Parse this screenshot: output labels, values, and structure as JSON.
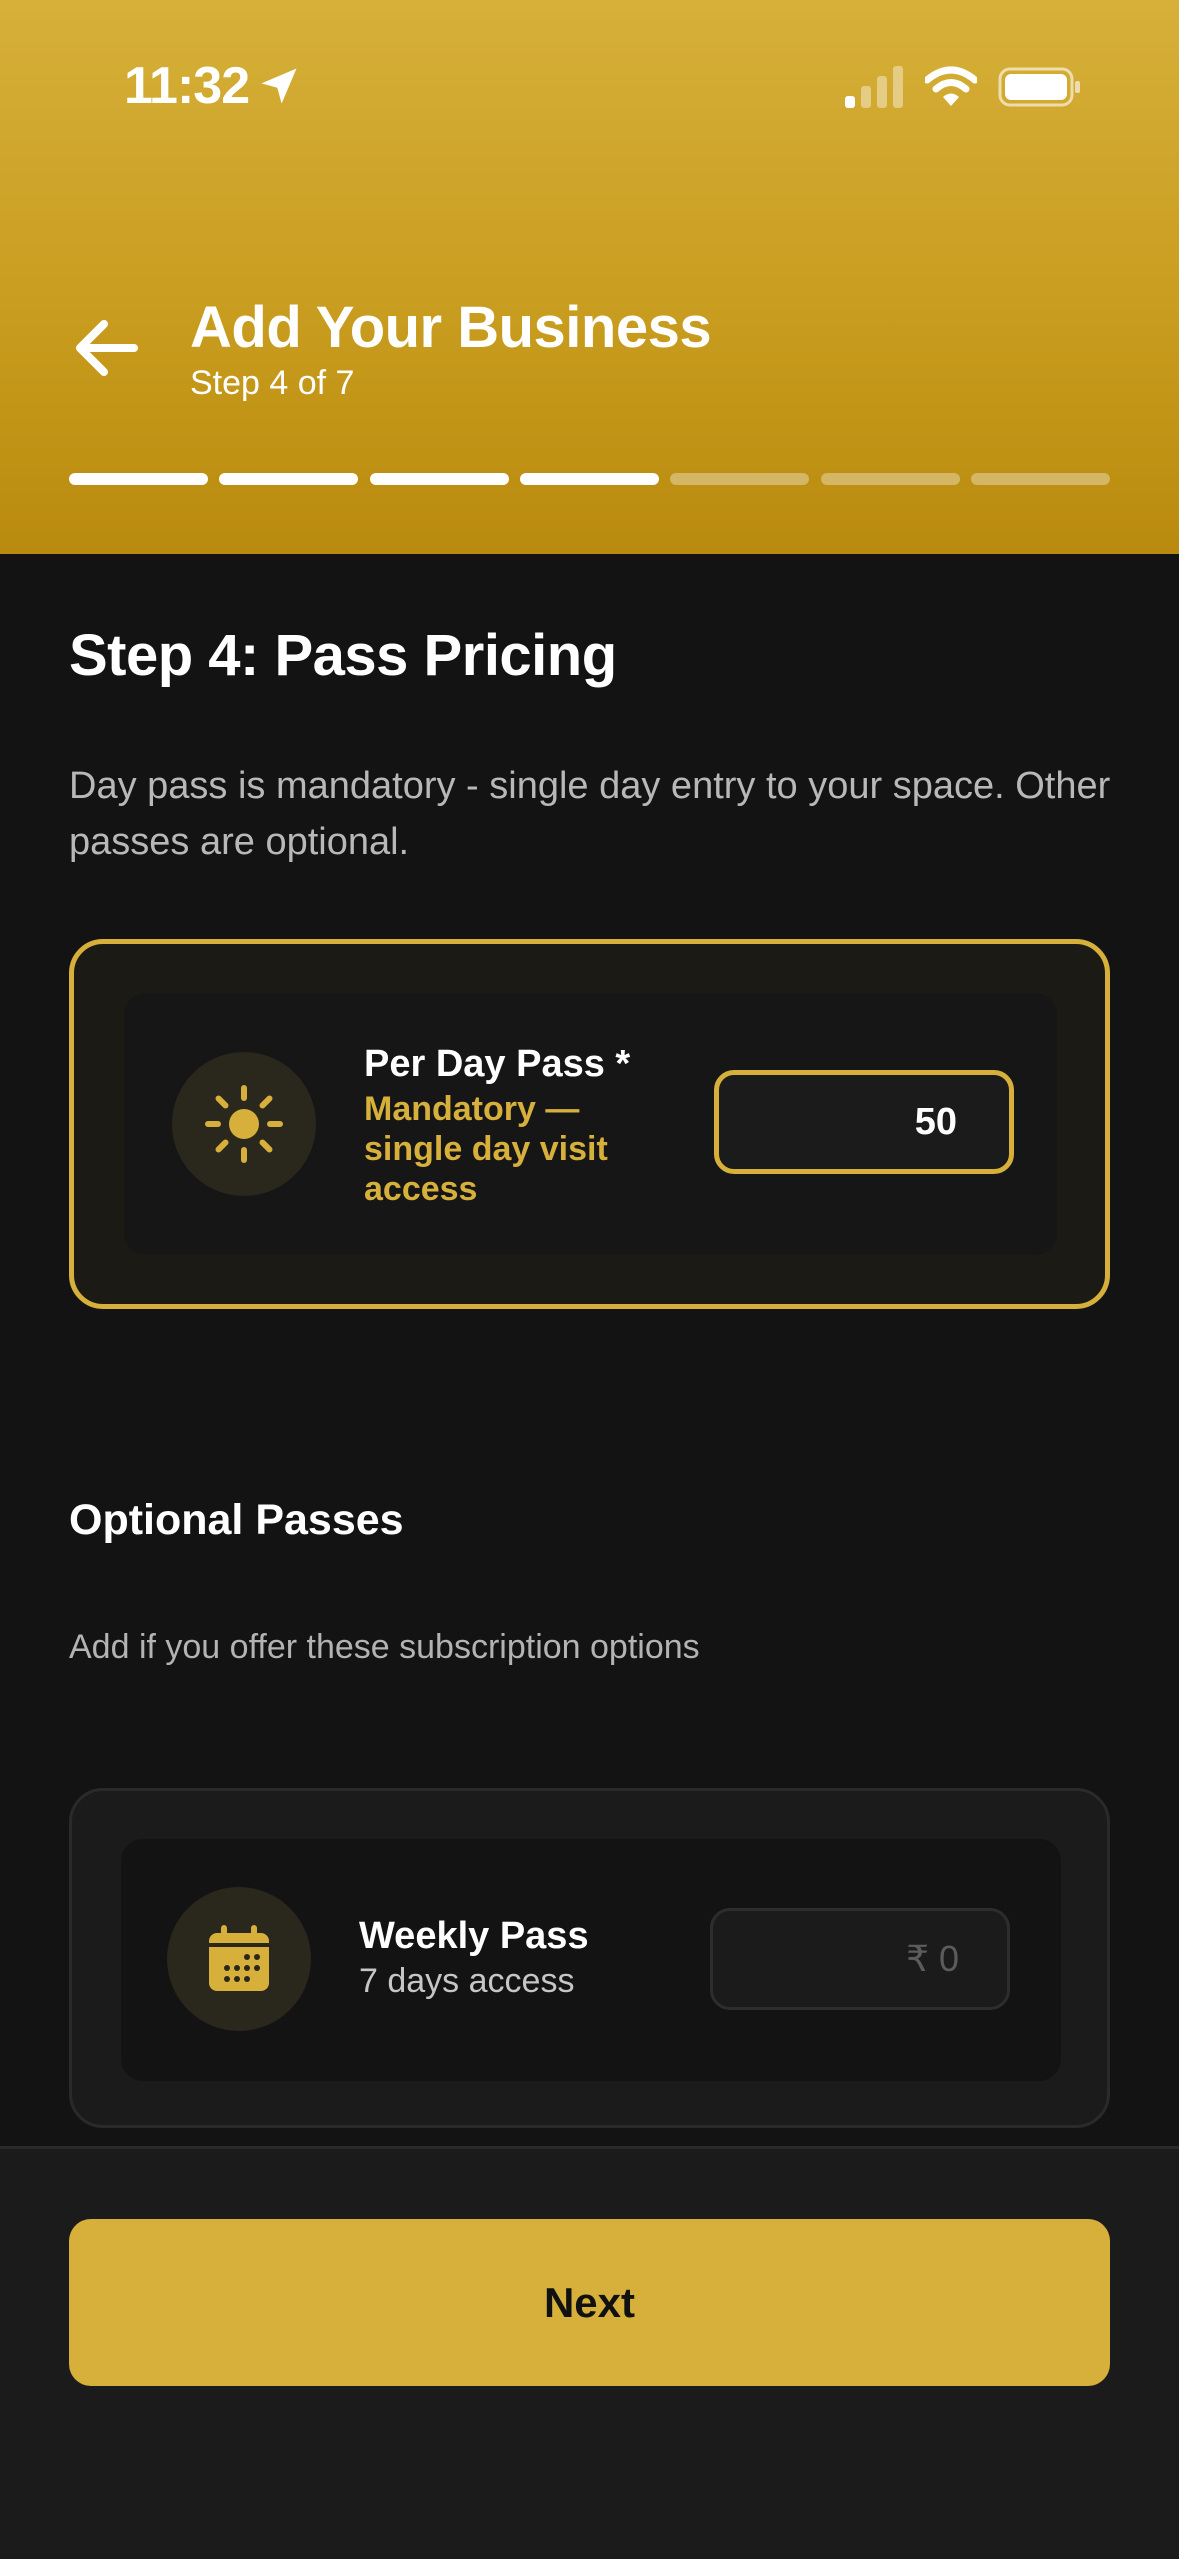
{
  "status_bar": {
    "time": "11:32"
  },
  "header": {
    "title": "Add Your Business",
    "subtitle": "Step 4 of 7",
    "progress": {
      "total_steps": 7,
      "completed_steps": 4
    }
  },
  "main": {
    "step_title": "Step 4: Pass Pricing",
    "description": "Day pass is mandatory - single day entry to your space. Other passes are optional.",
    "day_pass": {
      "name": "Per Day Pass *",
      "note": "Mandatory — single day visit access",
      "value": "50",
      "icon": "sun-icon"
    },
    "optional": {
      "title": "Optional Passes",
      "description": "Add if you offer these subscription options",
      "weekly": {
        "name": "Weekly Pass",
        "sub": "7 days access",
        "placeholder": "₹ 0",
        "icon": "calendar-icon"
      }
    }
  },
  "footer": {
    "next_label": "Next"
  },
  "colors": {
    "accent": "#d6b03a",
    "background": "#131313"
  }
}
